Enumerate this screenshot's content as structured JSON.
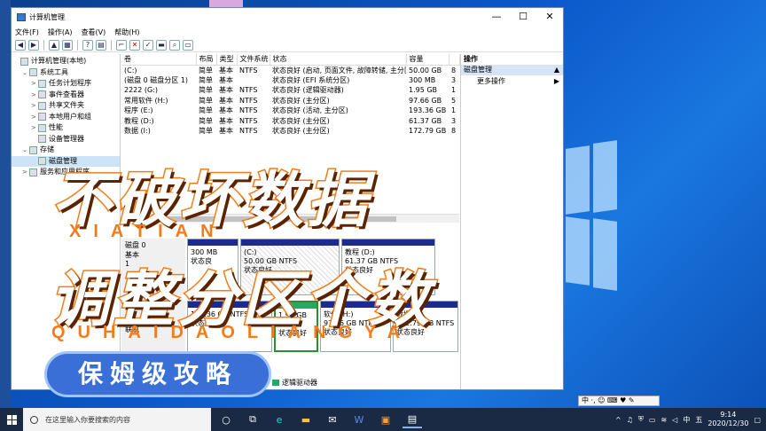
{
  "window": {
    "title": "计算机管理",
    "controls": [
      "—",
      "☐",
      "✕"
    ]
  },
  "menu": [
    "文件(F)",
    "操作(A)",
    "查看(V)",
    "帮助(H)"
  ],
  "tree": [
    {
      "label": "计算机管理(本地)",
      "level": 0,
      "expander": ""
    },
    {
      "label": "系统工具",
      "level": 1,
      "expander": "⌄"
    },
    {
      "label": "任务计划程序",
      "level": 2,
      "expander": ">"
    },
    {
      "label": "事件查看器",
      "level": 2,
      "expander": ">"
    },
    {
      "label": "共享文件夹",
      "level": 2,
      "expander": ">"
    },
    {
      "label": "本地用户和组",
      "level": 2,
      "expander": ">"
    },
    {
      "label": "性能",
      "level": 2,
      "expander": ">"
    },
    {
      "label": "设备管理器",
      "level": 2,
      "expander": ""
    },
    {
      "label": "存储",
      "level": 1,
      "expander": "⌄"
    },
    {
      "label": "磁盘管理",
      "level": 2,
      "expander": "",
      "selected": true
    },
    {
      "label": "服务和应用程序",
      "level": 1,
      "expander": ">"
    }
  ],
  "table": {
    "headers": [
      "卷",
      "布局",
      "类型",
      "文件系统",
      "状态",
      "容量",
      ""
    ],
    "rows": [
      [
        "(C:)",
        "简单",
        "基本",
        "NTFS",
        "状态良好 (启动, 页面文件, 故障转储, 主分区)",
        "50.00 GB",
        "8"
      ],
      [
        "(磁盘 0 磁盘分区 1)",
        "简单",
        "基本",
        "",
        "状态良好 (EFI 系统分区)",
        "300 MB",
        "3"
      ],
      [
        "2222 (G:)",
        "简单",
        "基本",
        "NTFS",
        "状态良好 (逻辑驱动器)",
        "1.95 GB",
        "1"
      ],
      [
        "常用软件 (H:)",
        "简单",
        "基本",
        "NTFS",
        "状态良好 (主分区)",
        "97.66 GB",
        "5"
      ],
      [
        "程序 (E:)",
        "简单",
        "基本",
        "NTFS",
        "状态良好 (活动, 主分区)",
        "193.36 GB",
        "1"
      ],
      [
        "教程 (D:)",
        "简单",
        "基本",
        "NTFS",
        "状态良好 (主分区)",
        "61.37 GB",
        "3"
      ],
      [
        "数据 (I:)",
        "简单",
        "基本",
        "NTFS",
        "状态良好 (主分区)",
        "172.79 GB",
        "8"
      ]
    ]
  },
  "diskmap": {
    "disk0": {
      "name": "磁盘 0",
      "type": "基本",
      "size_frag": "1"
    },
    "disk0_parts": [
      {
        "title": "",
        "line1": "300 MB",
        "line2": "状态良"
      },
      {
        "title": "(C:)",
        "line1": "50.00 GB NTFS",
        "line2": "状态良好"
      },
      {
        "title": "教程 (D:)",
        "line1": "61.37 GB NTFS",
        "line2": "状态良好"
      }
    ],
    "disk1": {
      "size": "465.76 GB",
      "status": "联机"
    },
    "disk1_parts": [
      {
        "title": "",
        "line1": "193.36 GB NTFS",
        "line2": "状态良好"
      },
      {
        "title": "",
        "line1": "1.95 GB N",
        "line2": "状态良好"
      },
      {
        "title": "软件 (H:)",
        "line1": "97.66 GB NTFS",
        "line2": "状态良好"
      },
      {
        "title": "数据 (I:)",
        "line1": "172.79 GB NTFS",
        "line2": "状态良好"
      }
    ],
    "legend": "逻辑驱动器"
  },
  "actions": {
    "header": "操作",
    "section": "磁盘管理",
    "more": "更多操作"
  },
  "overlay": {
    "title1": "不破坏数据",
    "pinyin1": "XIATIAN",
    "title2": "调整分区个数",
    "pinyin2": "QUHAIDAOLIANGYA",
    "badge": "保姆级攻略"
  },
  "taskbar": {
    "search_placeholder": "在这里输入你要搜索的内容",
    "time": "9:14",
    "date": "2020/12/30",
    "ime": "中",
    "input_mode": "五",
    "ime_bar": "中 ·, ☺ ⌨ ♥ ✎"
  }
}
